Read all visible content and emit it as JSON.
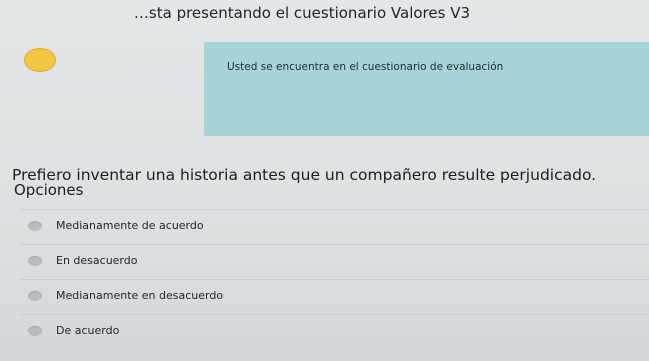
{
  "header": {
    "title": "…sta presentando el cuestionario Valores V3"
  },
  "status": {
    "indicator_color": "#f2c744"
  },
  "info_panel": {
    "text": "Usted se encuentra en el cuestionario de evaluación",
    "background": "#a8d3d8"
  },
  "question": {
    "text": "Prefiero inventar una historia antes que un compañero resulte perjudicado."
  },
  "options": {
    "label": "Opciones",
    "items": [
      {
        "label": "Medianamente de acuerdo"
      },
      {
        "label": "En desacuerdo"
      },
      {
        "label": "Medianamente en desacuerdo"
      },
      {
        "label": "De acuerdo"
      }
    ]
  }
}
